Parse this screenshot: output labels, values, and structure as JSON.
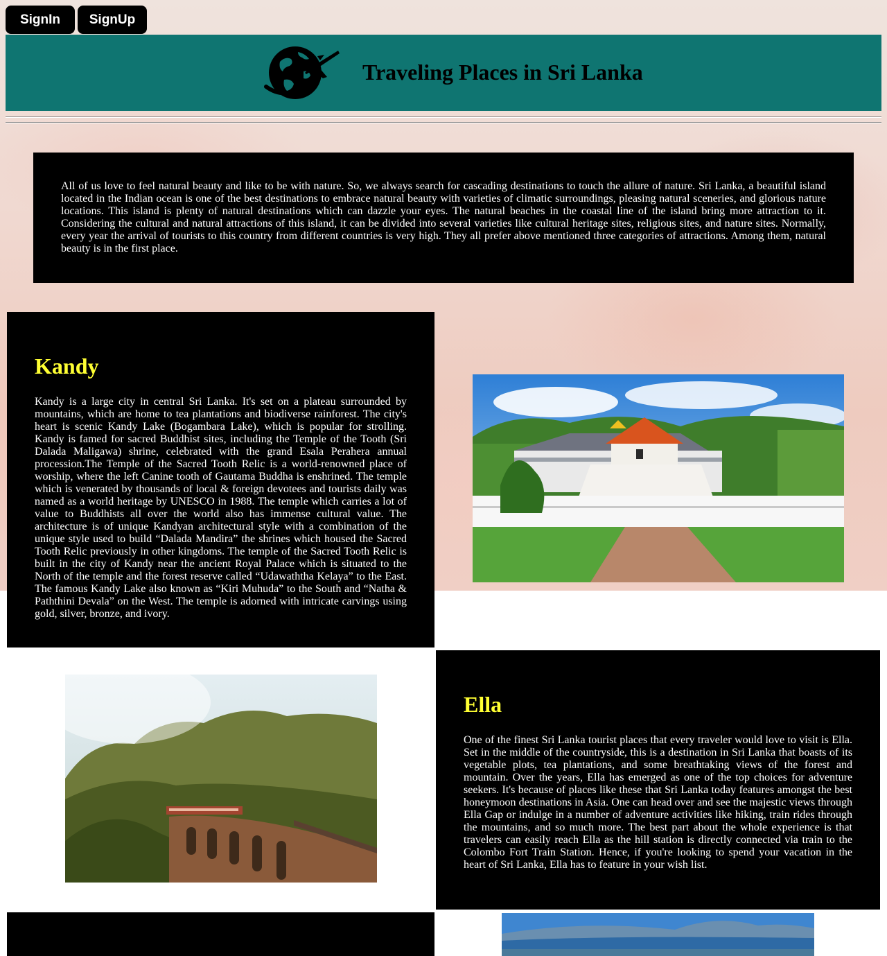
{
  "auth": {
    "signin_label": "SignIn",
    "signup_label": "SignUp"
  },
  "header": {
    "title": "Traveling Places in Sri Lanka",
    "logo_icon": "globe-plane-icon"
  },
  "intro": {
    "text": "All of us love to feel natural beauty and like to be with nature. So, we always search for cascading destinations to touch the allure of nature. Sri Lanka, a beautiful island located in the Indian ocean is one of the best destinations to embrace natural beauty with varieties of climatic surroundings, pleasing natural sceneries, and glorious nature locations. This island is plenty of natural destinations which can dazzle your eyes. The natural beaches in the coastal line of the island bring more attraction to it. Considering the cultural and natural attractions of this island, it can be divided into several varieties like cultural heritage sites, religious sites, and nature sites. Normally, every year the arrival of tourists to this country from different countries is very high. They all prefer above mentioned three categories of attractions. Among them, natural beauty is in the first place."
  },
  "places": [
    {
      "name": "Kandy",
      "description": "Kandy is a large city in central Sri Lanka. It's set on a plateau surrounded by mountains, which are home to tea plantations and biodiverse rainforest. The city's heart is scenic Kandy Lake (Bogambara Lake), which is popular for strolling. Kandy is famed for sacred Buddhist sites, including the Temple of the Tooth (Sri Dalada Maligawa) shrine, celebrated with the grand Esala Perahera annual procession.The Temple of the Sacred Tooth Relic is a world-renowned place of worship, where the left Canine tooth of Gautama Buddha is enshrined. The temple which is venerated by thousands of local & foreign devotees and tourists daily was named as a world heritage by UNESCO in 1988. The temple which carries a lot of value to Buddhists all over the world also has immense cultural value. The architecture is of unique Kandyan architectural style with a combination of the unique style used to build “Dalada Mandira” the shrines which housed the Sacred Tooth Relic previously in other kingdoms. The temple of the Sacred Tooth Relic is built in the city of Kandy near the ancient Royal Palace which is situated to the North of the temple and the forest reserve called “Udawaththa Kelaya” to the East. The famous Kandy Lake also known as “Kiri Muhuda” to the South and “Natha & Paththini Devala” on the West. The temple is adorned with intricate carvings using gold, silver, bronze, and ivory.",
      "image": "temple-of-the-tooth-photo"
    },
    {
      "name": "Ella",
      "description": "One of the finest Sri Lanka tourist places that every traveler would love to visit is Ella. Set in the middle of the countryside, this is a destination in Sri Lanka that boasts of its vegetable plots, tea plantations, and some breathtaking views of the forest and mountain. Over the years, Ella has emerged as one of the top choices for adventure seekers. It's because of places like these that Sri Lanka today features amongst the best honeymoon destinations in Asia. One can head over and see the majestic views through Ella Gap or indulge in a number of adventure activities like hiking, train rides through the mountains, and so much more. The best part about the whole experience is that travelers can easily reach Ella as the hill station is directly connected via train to the Colombo Fort Train Station. Hence, if you're looking to spend your vacation in the heart of Sri Lanka, Ella has to feature in your wish list.",
      "image": "nine-arch-bridge-photo"
    }
  ],
  "colors": {
    "header_bg": "#0f7571",
    "card_bg": "#000000",
    "heading": "#ffff33",
    "text": "#ffffff"
  }
}
